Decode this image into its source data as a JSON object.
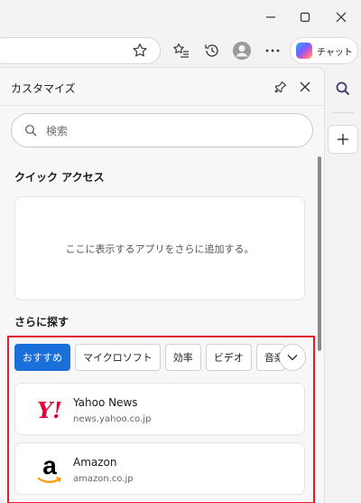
{
  "copilot": {
    "label": "チャット"
  },
  "panel": {
    "title": "カスタマイズ",
    "search_placeholder": "検索",
    "quick_access": {
      "heading": "クイック アクセス",
      "empty_text": "ここに表示するアプリをさらに追加する。"
    },
    "explore": {
      "heading": "さらに探す",
      "chips": [
        "おすすめ",
        "マイクロソフト",
        "効率",
        "ビデオ",
        "音楽"
      ],
      "selected_chip": "おすすめ",
      "apps": [
        {
          "name": "Yahoo News",
          "url": "news.yahoo.co.jp",
          "logo_text": "Y!",
          "logo_color": "#e60033"
        },
        {
          "name": "Amazon",
          "url": "amazon.co.jp",
          "logo_text": "a",
          "logo_color": "#000000",
          "accent_color": "#ff9900"
        }
      ]
    }
  },
  "colors": {
    "accent": "#1b6fd8",
    "highlight": "#e01e2b"
  }
}
